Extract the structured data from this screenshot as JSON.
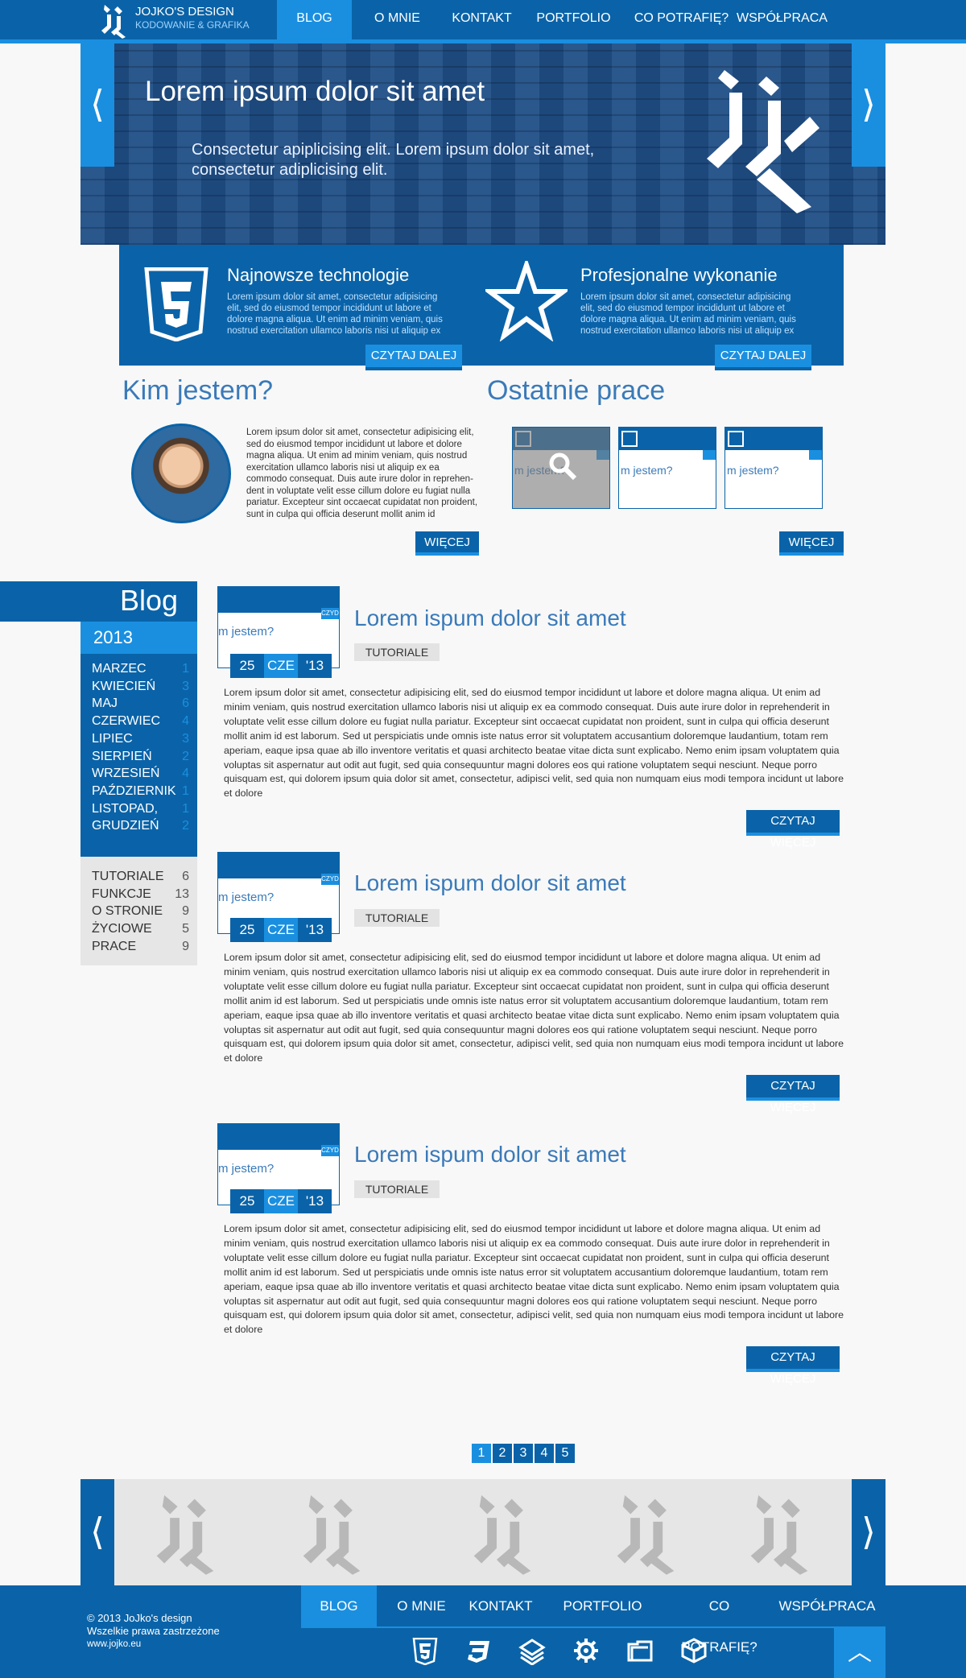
{
  "brand": {
    "title": "JOJKO'S DESIGN",
    "subtitle": "KODOWANIE & GRAFIKA"
  },
  "nav": [
    {
      "label": "BLOG",
      "active": true
    },
    {
      "label": "O MNIE"
    },
    {
      "label": "KONTAKT"
    },
    {
      "label": "PORTFOLIO"
    },
    {
      "label": "CO POTRAFIĘ?"
    },
    {
      "label": "WSPÓŁPRACA"
    }
  ],
  "slider": {
    "title": "Lorem ipsum dolor sit amet",
    "text": "Consectetur apiplicising elit. Lorem ipsum dolor sit amet, consectetur adiplicising elit.",
    "prev": "⟨",
    "next": "⟩"
  },
  "features": [
    {
      "title": "Najnowsze technologie",
      "text": "Lorem ipsum dolor sit amet, consectetur adipisicing elit, sed do eiusmod tempor incididunt ut labore et dolore magna aliqua. Ut enim ad minim veniam, quis nostrud exercitation ullamco laboris nisi ut aliquip ex",
      "button": "CZYTAJ DALEJ",
      "icon": "html5-shield-icon"
    },
    {
      "title": "Profesjonalne wykonanie",
      "text": "Lorem ipsum dolor sit amet, consectetur adipisicing elit, sed do eiusmod tempor incididunt ut labore et dolore magna aliqua. Ut enim ad minim veniam, quis nostrud exercitation ullamco laboris nisi ut aliquip ex",
      "button": "CZYTAJ DALEJ",
      "icon": "star-icon"
    }
  ],
  "about": {
    "heading": "Kim jestem?",
    "text": "Lorem ipsum dolor sit amet, consectetur adipisicing elit, sed do eiusmod tempor incididunt ut labore et dolore magna aliqua. Ut enim ad minim veniam, quis nostrud exercitation ullamco laboris nisi ut aliquip ex ea commodo consequat. Duis aute irure dolor in reprehen­dent in voluptate velit esse cillum dolore eu fugiat nulla pariatur. Excepteur sint occaecat cupidatat non proident, sunt in culpa qui officia deserunt mollit anim id",
    "button": "WIĘCEJ"
  },
  "works": {
    "heading": "Ostatnie prace",
    "thumb_text": "m jestem?",
    "button": "WIĘCEJ"
  },
  "blog_sidebar": {
    "heading": "Blog",
    "year": "2013",
    "months": [
      {
        "name": "MARZEC",
        "count": "1"
      },
      {
        "name": "KWIECIEŃ",
        "count": "3"
      },
      {
        "name": "MAJ",
        "count": "6"
      },
      {
        "name": "CZERWIEC",
        "count": "4"
      },
      {
        "name": "LIPIEC",
        "count": "3"
      },
      {
        "name": "SIERPIEŃ",
        "count": "2"
      },
      {
        "name": "WRZESIEŃ",
        "count": "4"
      },
      {
        "name": "PAŹDZIERNIK",
        "count": "1"
      },
      {
        "name": "LISTOPAD,",
        "count": "1"
      },
      {
        "name": "GRUDZIEŃ",
        "count": "2"
      }
    ],
    "categories": [
      {
        "name": "TUTORIALE",
        "count": "6"
      },
      {
        "name": "FUNKCJE",
        "count": "13"
      },
      {
        "name": "O STRONIE",
        "count": "9"
      },
      {
        "name": "ŻYCIOWE",
        "count": "5"
      },
      {
        "name": "PRACE",
        "count": "9"
      }
    ]
  },
  "posts": [
    {
      "title": "Lorem ispum dolor sit amet",
      "tag": "TUTORIALE",
      "day": "25",
      "month": "CZE",
      "year": "'13",
      "thumb_text": "m jestem?",
      "badge": "CZYD",
      "button": "CZYTAJ WIĘCEJ",
      "text": "Lorem ipsum dolor sit amet, consectetur adipisicing elit, sed do eiusmod tempor incididunt ut labore et dolore magna aliqua. Ut enim ad minim veniam, quis nostrud exercitation ullamco laboris nisi ut aliquip ex ea commodo consequat. Duis aute irure dolor in reprehenderit in voluptate velit esse cillum dolore eu fugiat nulla pariatur. Excepteur sint occaecat cupidatat non proident, sunt in culpa qui officia deserunt mollit anim id est laborum. Sed ut perspiciatis unde omnis iste natus error sit voluptatem accusantium doloremque laudantium, totam rem aperiam, eaque ipsa quae ab illo inventore veritatis et quasi architecto beatae vitae dicta sunt explicabo. Nemo enim ipsam voluptatem quia voluptas sit aspernatur aut odit aut fugit, sed quia consequuntur magni dolores eos qui ratione voluptatem sequi nesciunt. Neque porro quisquam est, qui dolorem ipsum quia dolor sit amet, consectetur, adipisci velit, sed quia non numquam eius modi tempora incidunt ut labore et dolore"
    },
    {
      "title": "Lorem ispum dolor sit amet",
      "tag": "TUTORIALE",
      "day": "25",
      "month": "CZE",
      "year": "'13",
      "thumb_text": "m jestem?",
      "badge": "CZYD",
      "button": "CZYTAJ WIĘCEJ",
      "text": "Lorem ipsum dolor sit amet, consectetur adipisicing elit, sed do eiusmod tempor incididunt ut labore et dolore magna aliqua. Ut enim ad minim veniam, quis nostrud exercitation ullamco laboris nisi ut aliquip ex ea commodo consequat. Duis aute irure dolor in reprehenderit in voluptate velit esse cillum dolore eu fugiat nulla pariatur. Excepteur sint occaecat cupidatat non proident, sunt in culpa qui officia deserunt mollit anim id est laborum. Sed ut perspiciatis unde omnis iste natus error sit voluptatem accusantium doloremque laudantium, totam rem aperiam, eaque ipsa quae ab illo inventore veritatis et quasi architecto beatae vitae dicta sunt explicabo. Nemo enim ipsam voluptatem quia voluptas sit aspernatur aut odit aut fugit, sed quia consequuntur magni dolores eos qui ratione voluptatem sequi nesciunt. Neque porro quisquam est, qui dolorem ipsum quia dolor sit amet, consectetur, adipisci velit, sed quia non numquam eius modi tempora incidunt ut labore et dolore"
    },
    {
      "title": "Lorem ispum dolor sit amet",
      "tag": "TUTORIALE",
      "day": "25",
      "month": "CZE",
      "year": "'13",
      "thumb_text": "m jestem?",
      "badge": "CZYD",
      "button": "CZYTAJ WIĘCEJ",
      "text": "Lorem ipsum dolor sit amet, consectetur adipisicing elit, sed do eiusmod tempor incididunt ut labore et dolore magna aliqua. Ut enim ad minim veniam, quis nostrud exercitation ullamco laboris nisi ut aliquip ex ea commodo consequat. Duis aute irure dolor in reprehenderit in voluptate velit esse cillum dolore eu fugiat nulla pariatur. Excepteur sint occaecat cupidatat non proident, sunt in culpa qui officia deserunt mollit anim id est laborum. Sed ut perspiciatis unde omnis iste natus error sit voluptatem accusantium doloremque laudantium, totam rem aperiam, eaque ipsa quae ab illo inventore veritatis et quasi architecto beatae vitae dicta sunt explicabo. Nemo enim ipsam voluptatem quia voluptas sit aspernatur aut odit aut fugit, sed quia consequuntur magni dolores eos qui ratione voluptatem sequi nesciunt. Neque porro quisquam est, qui dolorem ipsum quia dolor sit amet, consectetur, adipisci velit, sed quia non numquam eius modi tempora incidunt ut labore et dolore"
    }
  ],
  "pagination": [
    {
      "label": "1",
      "active": true
    },
    {
      "label": "2"
    },
    {
      "label": "3"
    },
    {
      "label": "4"
    },
    {
      "label": "5"
    }
  ],
  "logos_slider": {
    "prev": "⟨",
    "next": "⟩"
  },
  "footer": {
    "copyright": "© 2013 JoJko's design",
    "rights": "Wszelkie prawa zastrzeżone",
    "url": "www.jojko.eu",
    "icons": [
      "html5-icon",
      "css3-icon",
      "layers-icon",
      "gear-icon",
      "box-open-icon",
      "cube-icon"
    ],
    "to_top": "︿"
  },
  "colors": {
    "primary": "#0a63a8",
    "accent": "#1a8fe0"
  }
}
